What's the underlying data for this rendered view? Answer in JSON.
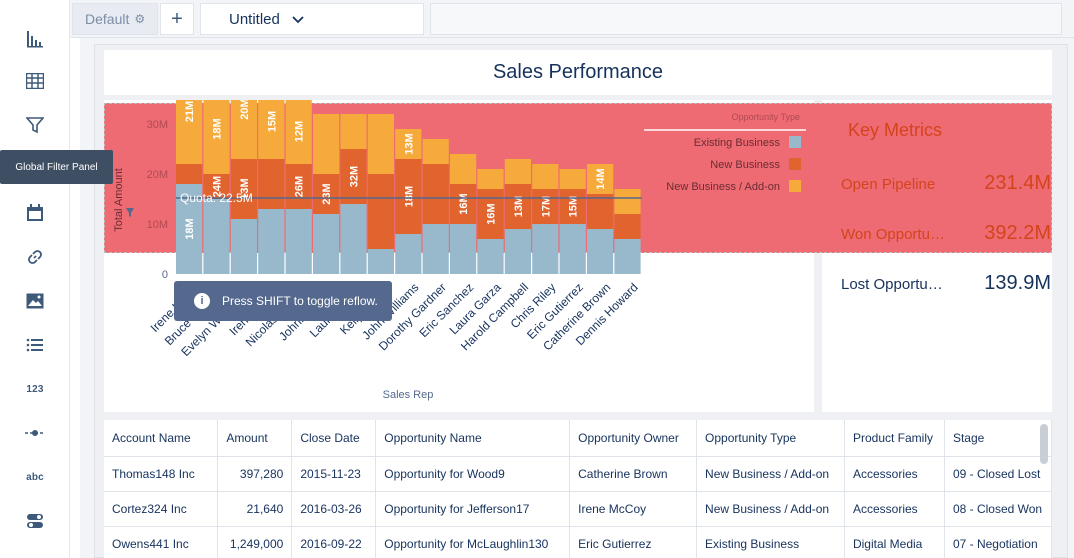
{
  "tabs": {
    "default_label": "Default",
    "untitled_label": "Untitled"
  },
  "rail": {
    "tooltip": "Global Filter Panel",
    "number_label": "123",
    "text_label": "abc"
  },
  "dashboard": {
    "title": "Sales Performance"
  },
  "chart_data": {
    "type": "bar",
    "stacked": true,
    "xlabel": "Sales Rep",
    "ylabel": "Total Amount",
    "legend_title": "Opportunity Type",
    "legend_position": "top-right",
    "ytick_labels": [
      "0",
      "10M",
      "20M",
      "30M"
    ],
    "ylim": [
      0,
      30
    ],
    "reference_line": {
      "label": "Quota: 22.5M",
      "value": 15.2
    },
    "categories": [
      "Irene Kelley",
      "Bruce Kennedy",
      "Evelyn Williamson",
      "Irene McCoy",
      "Nicolas Weaver",
      "Johnny Green",
      "Laura Larson",
      "Kelly Frazier",
      "John Williams",
      "Dorothy Gardner",
      "Eric Sanchez",
      "Laura Garza",
      "Harold Campbell",
      "Chris Riley",
      "Eric Gutierrez",
      "Catherine Brown",
      "Dennis Howard"
    ],
    "series": [
      {
        "name": "Existing Business",
        "color": "#97b9cb",
        "values": [
          18,
          15,
          11,
          13,
          13,
          12,
          14,
          5,
          8,
          10,
          10,
          7,
          9,
          10,
          10,
          9,
          7
        ],
        "labels": [
          "18M",
          "",
          "",
          "",
          "",
          "",
          "",
          "",
          "",
          "",
          "",
          "",
          "",
          "",
          "",
          "",
          ""
        ]
      },
      {
        "name": "New Business",
        "color": "#e1632e",
        "values": [
          4,
          5,
          12,
          10,
          9,
          8,
          11,
          15,
          15,
          12,
          8,
          10,
          9,
          7,
          7,
          7,
          5
        ],
        "labels": [
          "",
          "24M",
          "13M",
          "",
          "26M",
          "23M",
          "32M",
          "",
          "18M",
          "",
          "16M",
          "16M",
          "13M",
          "17M",
          "15M",
          "",
          ""
        ]
      },
      {
        "name": "New Business / Add-on",
        "color": "#f6aa3b",
        "values": [
          21,
          18,
          20,
          15,
          13,
          12,
          7,
          12,
          6,
          5,
          6,
          4,
          5,
          5,
          4,
          6,
          5
        ],
        "labels": [
          "21M",
          "18M",
          "20M",
          "15M",
          "12M",
          "",
          "",
          "",
          "13M",
          "",
          "",
          "",
          "",
          "",
          "",
          "14M",
          ""
        ]
      }
    ]
  },
  "metrics": {
    "title": "Key Metrics",
    "items": [
      {
        "label": "Open Pipeline",
        "value": "231.4M"
      },
      {
        "label": "Won Opportunities",
        "value": "392.2M"
      },
      {
        "label": "Lost Opportunities",
        "value": "139.9M"
      }
    ]
  },
  "toast": {
    "text": "Press SHIFT to toggle reflow."
  },
  "table": {
    "columns": [
      "Account Name",
      "Amount",
      "Close Date",
      "Opportunity Name",
      "Opportunity Owner",
      "Opportunity Type",
      "Product Family",
      "Stage"
    ],
    "rows": [
      [
        "Thomas148 Inc",
        "397,280",
        "2015-11-23",
        "Opportunity for Wood9",
        "Catherine Brown",
        "New Business / Add-on",
        "Accessories",
        "09 - Closed Lost"
      ],
      [
        "Cortez324 Inc",
        "21,640",
        "2016-03-26",
        "Opportunity for Jefferson17",
        "Irene McCoy",
        "New Business / Add-on",
        "Accessories",
        "08 - Closed Won"
      ],
      [
        "Owens441 Inc",
        "1,249,000",
        "2016-09-22",
        "Opportunity for McLaughlin130",
        "Eric Gutierrez",
        "Existing Business",
        "Digital Media",
        "07 - Negotiation"
      ]
    ]
  }
}
